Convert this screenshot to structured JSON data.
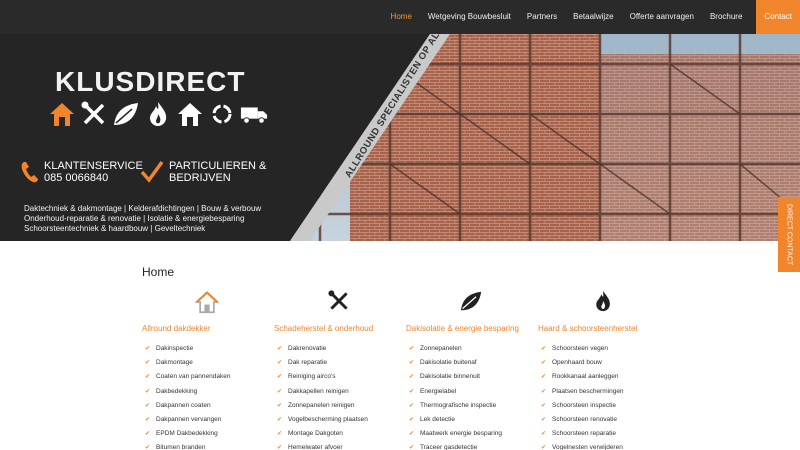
{
  "nav": {
    "items": [
      "Home",
      "Wetgeving Bouwbesluit",
      "Partners",
      "Betaalwijze",
      "Offerte aanvragen",
      "Brochure"
    ],
    "contact": "Contact"
  },
  "hero": {
    "brand": "KLUSDIRECT",
    "service_title": "KLANTENSERVICE",
    "service_phone": "085 0066840",
    "particulieren_line1": "PARTICULIEREN &",
    "particulieren_line2": "BEDRIJVEN",
    "tagline": [
      "Daktechniek & dakmontage | Kelderafdichtingen | Bouw & verbouw",
      "Onderhoud-reparatie & renovatie | Isolatie & energiebesparing",
      "Schoorsteentechniek & haardbouw | Geveltechniek"
    ],
    "diagonal": "ALLROUND SPECIALISTEN OP ALLE VAKGEBIEDEN",
    "accent": "#f0852c"
  },
  "side_tab": "DIRECT CONTACT",
  "page_title": "Home",
  "columns": [
    {
      "title": "Allround dakdekker",
      "icon": "house-icon",
      "items": [
        "Dakinspectie",
        "Dakmontage",
        "Coaten van pannendaken",
        "Dakbedekking",
        "Dakpannen coaten",
        "Dakpannen vervangen",
        "EPDM Dakbedekking",
        "Bitumen branden"
      ]
    },
    {
      "title": "Schadeherstel & onderhoud",
      "icon": "tools-icon",
      "items": [
        "Dakrenovatie",
        "Dak reparatie",
        "Reiniging airco's",
        "Dakkapellen reinigen",
        "Zonnepanelen reinigen",
        "Vogelbescherming plaatsen",
        "Montage Dakgoten",
        "Hemelwater afvoer"
      ]
    },
    {
      "title": "Dakisolatie & energie besparing",
      "icon": "leaf-icon",
      "items": [
        "Zonnepanelen",
        "Dakisolatie buitenaf",
        "Dakisolatie binnenuit",
        "Energielabel",
        "Thermografische inspectie",
        "Lek detectie",
        "Maatwerk energie besparing",
        "Traceer gasdetectie"
      ]
    },
    {
      "title": "Haard & schoorsteenherstel",
      "icon": "flame-icon",
      "items": [
        "Schoorsteen vegen",
        "Openhaard bouw",
        "Rookkanaal aanleggen",
        "Plaatsen beschermingen",
        "Schoorsteen inspectie",
        "Schoorsteen renovatie",
        "Schoorsteen reparatie",
        "Vogelnesten verwijderen"
      ]
    }
  ]
}
